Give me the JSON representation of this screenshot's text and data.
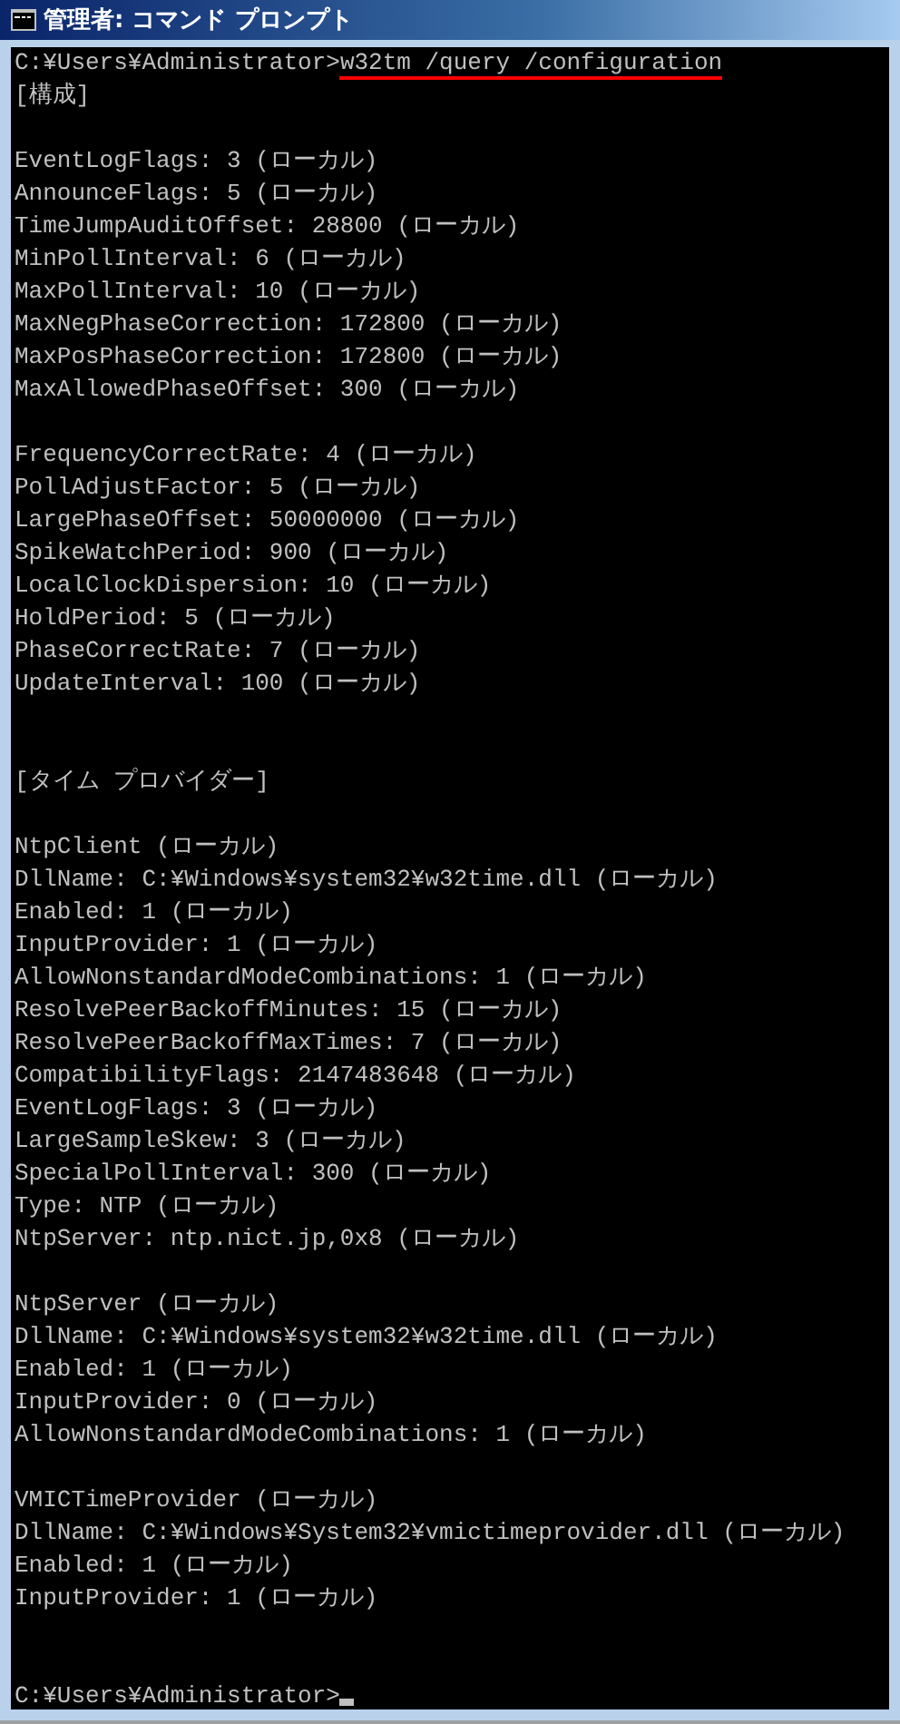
{
  "window": {
    "title": "管理者: コマンド プロンプト"
  },
  "console": {
    "prompt": "C:¥Users¥Administrator>",
    "command": "w32tm /query /configuration",
    "groups": [
      [
        [
          "[構成]"
        ],
        [
          "EventLogFlags: 3 (ローカル)",
          "AnnounceFlags: 5 (ローカル)",
          "TimeJumpAuditOffset: 28800 (ローカル)",
          "MinPollInterval: 6 (ローカル)",
          "MaxPollInterval: 10 (ローカル)",
          "MaxNegPhaseCorrection: 172800 (ローカル)",
          "MaxPosPhaseCorrection: 172800 (ローカル)",
          "MaxAllowedPhaseOffset: 300 (ローカル)"
        ],
        [
          "FrequencyCorrectRate: 4 (ローカル)",
          "PollAdjustFactor: 5 (ローカル)",
          "LargePhaseOffset: 50000000 (ローカル)",
          "SpikeWatchPeriod: 900 (ローカル)",
          "LocalClockDispersion: 10 (ローカル)",
          "HoldPeriod: 5 (ローカル)",
          "PhaseCorrectRate: 7 (ローカル)",
          "UpdateInterval: 100 (ローカル)"
        ]
      ],
      [
        [
          "[タイム プロバイダー]"
        ],
        [
          "NtpClient (ローカル)",
          "DllName: C:¥Windows¥system32¥w32time.dll (ローカル)",
          "Enabled: 1 (ローカル)",
          "InputProvider: 1 (ローカル)",
          "AllowNonstandardModeCombinations: 1 (ローカル)",
          "ResolvePeerBackoffMinutes: 15 (ローカル)",
          "ResolvePeerBackoffMaxTimes: 7 (ローカル)",
          "CompatibilityFlags: 2147483648 (ローカル)",
          "EventLogFlags: 3 (ローカル)",
          "LargeSampleSkew: 3 (ローカル)",
          "SpecialPollInterval: 300 (ローカル)",
          "Type: NTP (ローカル)",
          "NtpServer: ntp.nict.jp,0x8 (ローカル)"
        ],
        [
          "NtpServer (ローカル)",
          "DllName: C:¥Windows¥system32¥w32time.dll (ローカル)",
          "Enabled: 1 (ローカル)",
          "InputProvider: 0 (ローカル)",
          "AllowNonstandardModeCombinations: 1 (ローカル)"
        ],
        [
          "VMICTimeProvider (ローカル)",
          "DllName: C:¥Windows¥System32¥vmictimeprovider.dll (ローカル)",
          "Enabled: 1 (ローカル)",
          "InputProvider: 1 (ローカル)"
        ]
      ]
    ],
    "final_prompt": "C:¥Users¥Administrator>"
  }
}
